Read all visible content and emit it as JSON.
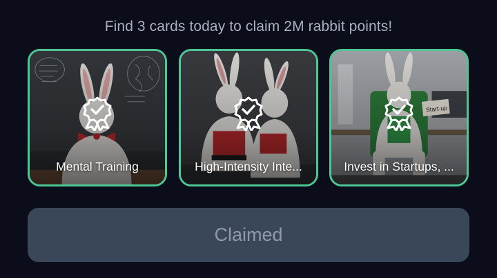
{
  "headline": "Find 3 cards today to claim 2M rabbit points!",
  "cards": [
    {
      "title": "Mental Training",
      "icon": "award-badge-icon",
      "scene": "rabbit-at-chalkboard"
    },
    {
      "title": "High-Intensity Inte...",
      "icon": "award-badge-icon",
      "scene": "rabbits-martial-arts"
    },
    {
      "title": "Invest in Startups, ...",
      "icon": "award-badge-icon",
      "scene": "rabbit-in-office-chair"
    }
  ],
  "claim_button": {
    "label": "Claimed",
    "state": "disabled"
  },
  "colors": {
    "background": "#0b0d1b",
    "card_border": "#4ec796",
    "button_bg": "#3a4759",
    "button_text": "#8f9aab",
    "headline_text": "#a9b0bd"
  }
}
